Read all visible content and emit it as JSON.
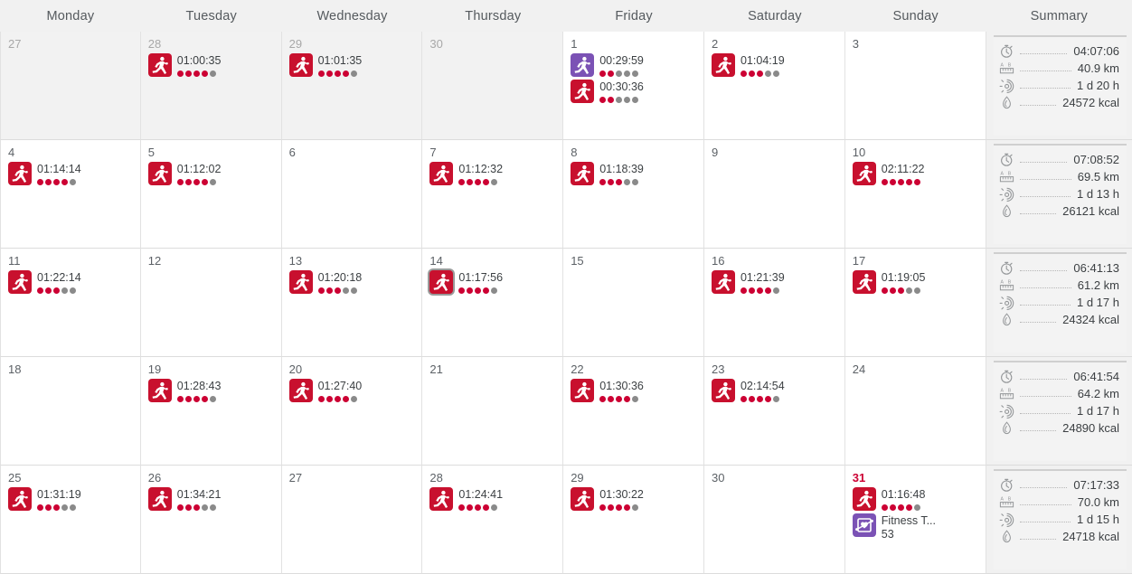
{
  "header": {
    "weekdays": [
      "Monday",
      "Tuesday",
      "Wednesday",
      "Thursday",
      "Friday",
      "Saturday",
      "Sunday"
    ],
    "summary_label": "Summary"
  },
  "icons": {
    "run": "running-icon",
    "fitness_test": "fitness-test-heart-icon",
    "duration": "stopwatch-icon",
    "distance": "ruler-distance-icon",
    "recovery": "recovery-sun-icon",
    "calories": "flame-icon"
  },
  "colors": {
    "run_red": "#c8102e",
    "run_purple": "#7b52b5",
    "dot_on": "#cc0033",
    "dot_off": "#8a8a8a",
    "today": "#cc0033"
  },
  "weeks": [
    {
      "days": [
        {
          "number": "27",
          "other_month": true,
          "entries": []
        },
        {
          "number": "28",
          "other_month": true,
          "entries": [
            {
              "icon": "run-red",
              "title": "01:00:35",
              "dots_on": 4,
              "dots_total": 5
            }
          ]
        },
        {
          "number": "29",
          "other_month": true,
          "entries": [
            {
              "icon": "run-red",
              "title": "01:01:35",
              "dots_on": 4,
              "dots_total": 5
            }
          ]
        },
        {
          "number": "30",
          "other_month": true,
          "entries": []
        },
        {
          "number": "1",
          "other_month": false,
          "entries": [
            {
              "icon": "run-purple",
              "title": "00:29:59",
              "dots_on": 2,
              "dots_total": 5
            },
            {
              "icon": "run-red",
              "title": "00:30:36",
              "dots_on": 2,
              "dots_total": 5
            }
          ]
        },
        {
          "number": "2",
          "other_month": false,
          "entries": [
            {
              "icon": "run-red",
              "title": "01:04:19",
              "dots_on": 3,
              "dots_total": 5
            }
          ]
        },
        {
          "number": "3",
          "other_month": false,
          "entries": []
        }
      ],
      "summary": {
        "duration": "04:07:06",
        "distance": "40.9 km",
        "recovery": "1 d 20 h",
        "calories": "24572 kcal"
      }
    },
    {
      "days": [
        {
          "number": "4",
          "other_month": false,
          "entries": [
            {
              "icon": "run-red",
              "title": "01:14:14",
              "dots_on": 4,
              "dots_total": 5
            }
          ]
        },
        {
          "number": "5",
          "other_month": false,
          "entries": [
            {
              "icon": "run-red",
              "title": "01:12:02",
              "dots_on": 4,
              "dots_total": 5
            }
          ]
        },
        {
          "number": "6",
          "other_month": false,
          "entries": []
        },
        {
          "number": "7",
          "other_month": false,
          "entries": [
            {
              "icon": "run-red",
              "title": "01:12:32",
              "dots_on": 4,
              "dots_total": 5
            }
          ]
        },
        {
          "number": "8",
          "other_month": false,
          "entries": [
            {
              "icon": "run-red",
              "title": "01:18:39",
              "dots_on": 3,
              "dots_total": 5
            }
          ]
        },
        {
          "number": "9",
          "other_month": false,
          "entries": []
        },
        {
          "number": "10",
          "other_month": false,
          "entries": [
            {
              "icon": "run-red",
              "title": "02:11:22",
              "dots_on": 5,
              "dots_total": 5
            }
          ]
        }
      ],
      "summary": {
        "duration": "07:08:52",
        "distance": "69.5 km",
        "recovery": "1 d 13 h",
        "calories": "26121 kcal"
      }
    },
    {
      "days": [
        {
          "number": "11",
          "other_month": false,
          "entries": [
            {
              "icon": "run-red",
              "title": "01:22:14",
              "dots_on": 3,
              "dots_total": 5
            }
          ]
        },
        {
          "number": "12",
          "other_month": false,
          "entries": []
        },
        {
          "number": "13",
          "other_month": false,
          "entries": [
            {
              "icon": "run-red",
              "title": "01:20:18",
              "dots_on": 3,
              "dots_total": 5
            }
          ]
        },
        {
          "number": "14",
          "other_month": false,
          "entries": [
            {
              "icon": "run-red",
              "title": "01:17:56",
              "dots_on": 4,
              "dots_total": 5,
              "selected": true
            }
          ]
        },
        {
          "number": "15",
          "other_month": false,
          "entries": []
        },
        {
          "number": "16",
          "other_month": false,
          "entries": [
            {
              "icon": "run-red",
              "title": "01:21:39",
              "dots_on": 4,
              "dots_total": 5
            }
          ]
        },
        {
          "number": "17",
          "other_month": false,
          "entries": [
            {
              "icon": "run-red",
              "title": "01:19:05",
              "dots_on": 3,
              "dots_total": 5
            }
          ]
        }
      ],
      "summary": {
        "duration": "06:41:13",
        "distance": "61.2 km",
        "recovery": "1 d 17 h",
        "calories": "24324 kcal"
      }
    },
    {
      "days": [
        {
          "number": "18",
          "other_month": false,
          "entries": []
        },
        {
          "number": "19",
          "other_month": false,
          "entries": [
            {
              "icon": "run-red",
              "title": "01:28:43",
              "dots_on": 4,
              "dots_total": 5
            }
          ]
        },
        {
          "number": "20",
          "other_month": false,
          "entries": [
            {
              "icon": "run-red",
              "title": "01:27:40",
              "dots_on": 4,
              "dots_total": 5
            }
          ]
        },
        {
          "number": "21",
          "other_month": false,
          "entries": []
        },
        {
          "number": "22",
          "other_month": false,
          "entries": [
            {
              "icon": "run-red",
              "title": "01:30:36",
              "dots_on": 4,
              "dots_total": 5
            }
          ]
        },
        {
          "number": "23",
          "other_month": false,
          "entries": [
            {
              "icon": "run-red",
              "title": "02:14:54",
              "dots_on": 4,
              "dots_total": 5
            }
          ]
        },
        {
          "number": "24",
          "other_month": false,
          "entries": []
        }
      ],
      "summary": {
        "duration": "06:41:54",
        "distance": "64.2 km",
        "recovery": "1 d 17 h",
        "calories": "24890 kcal"
      }
    },
    {
      "days": [
        {
          "number": "25",
          "other_month": false,
          "entries": [
            {
              "icon": "run-red",
              "title": "01:31:19",
              "dots_on": 3,
              "dots_total": 5
            }
          ]
        },
        {
          "number": "26",
          "other_month": false,
          "entries": [
            {
              "icon": "run-red",
              "title": "01:34:21",
              "dots_on": 3,
              "dots_total": 5
            }
          ]
        },
        {
          "number": "27",
          "other_month": false,
          "entries": []
        },
        {
          "number": "28",
          "other_month": false,
          "entries": [
            {
              "icon": "run-red",
              "title": "01:24:41",
              "dots_on": 4,
              "dots_total": 5
            }
          ]
        },
        {
          "number": "29",
          "other_month": false,
          "entries": [
            {
              "icon": "run-red",
              "title": "01:30:22",
              "dots_on": 4,
              "dots_total": 5
            }
          ]
        },
        {
          "number": "30",
          "other_month": false,
          "entries": []
        },
        {
          "number": "31",
          "other_month": false,
          "today": true,
          "entries": [
            {
              "icon": "run-red",
              "title": "01:16:48",
              "dots_on": 4,
              "dots_total": 5
            },
            {
              "icon": "fitness",
              "title": "Fitness T...",
              "subtitle": "53"
            }
          ]
        }
      ],
      "summary": {
        "duration": "07:17:33",
        "distance": "70.0 km",
        "recovery": "1 d 15 h",
        "calories": "24718 kcal"
      }
    }
  ]
}
